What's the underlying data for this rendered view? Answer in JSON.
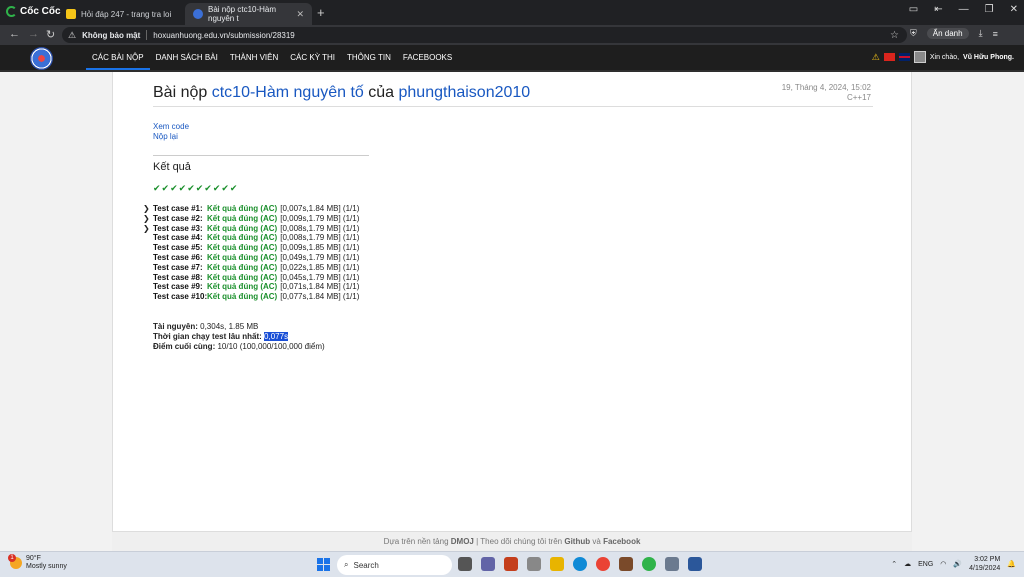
{
  "browser": {
    "brand": "Cốc Cốc",
    "tabs": [
      {
        "title": "Hỏi đáp 247 - trang tra loi"
      },
      {
        "title": "Bài nộp ctc10-Hàm nguyên t"
      }
    ],
    "security_label": "Không bảo mật",
    "url": "hoxuanhuong.edu.vn/submission/28319",
    "incognito_label": "Ẩn danh"
  },
  "site": {
    "menu": [
      "CÁC BÀI NỘP",
      "DANH SÁCH BÀI",
      "THÀNH VIÊN",
      "CÁC KỲ THI",
      "THÔNG TIN",
      "FACEBOOKS"
    ],
    "greeting_prefix": "Xin chào,",
    "username": "Vũ Hữu Phong."
  },
  "submission": {
    "title_prefix": "Bài nộp",
    "problem": "ctc10-Hàm nguyên tố",
    "of": "của",
    "user": "phungthaison2010",
    "date": "19, Tháng 4, 2024, 15:02",
    "language": "C++17",
    "view_code": "Xem code",
    "resubmit": "Nộp lại",
    "result_heading": "Kết quả",
    "check_count": 10,
    "cases": [
      {
        "label": "Test case #1:",
        "status": "Kết quả đúng (AC)",
        "detail": "[0,007s,1.84 MB] (1/1)",
        "expandable": true
      },
      {
        "label": "Test case #2:",
        "status": "Kết quả đúng (AC)",
        "detail": "[0,009s,1.79 MB] (1/1)",
        "expandable": true
      },
      {
        "label": "Test case #3:",
        "status": "Kết quả đúng (AC)",
        "detail": "[0,008s,1.79 MB] (1/1)",
        "expandable": true
      },
      {
        "label": "Test case #4:",
        "status": "Kết quả đúng (AC)",
        "detail": "[0,008s,1.79 MB] (1/1)",
        "expandable": false
      },
      {
        "label": "Test case #5:",
        "status": "Kết quả đúng (AC)",
        "detail": "[0,009s,1.85 MB] (1/1)",
        "expandable": false
      },
      {
        "label": "Test case #6:",
        "status": "Kết quả đúng (AC)",
        "detail": "[0,049s,1.79 MB] (1/1)",
        "expandable": false
      },
      {
        "label": "Test case #7:",
        "status": "Kết quả đúng (AC)",
        "detail": "[0,022s,1.85 MB] (1/1)",
        "expandable": false
      },
      {
        "label": "Test case #8:",
        "status": "Kết quả đúng (AC)",
        "detail": "[0,045s,1.79 MB] (1/1)",
        "expandable": false
      },
      {
        "label": "Test case #9:",
        "status": "Kết quả đúng (AC)",
        "detail": "[0,071s,1.84 MB] (1/1)",
        "expandable": false
      },
      {
        "label": "Test case #10:",
        "status": "Kết quả đúng (AC)",
        "detail": "[0,077s,1.84 MB] (1/1)",
        "expandable": false
      }
    ],
    "resources_label": "Tài nguyên:",
    "resources_value": "0,304s, 1.85 MB",
    "longest_label": "Thời gian chạy test lâu nhất:",
    "longest_value": "0,077s",
    "score_label": "Điểm cuối cùng:",
    "score_value": "10/10 (100,000/100,000 điểm)"
  },
  "footer": {
    "prefix": "Dựa trên nền tảng",
    "platform": "DMOJ",
    "middle": "| Theo dõi chúng tôi trên",
    "github": "Github",
    "and": "và",
    "facebook": "Facebook"
  },
  "taskbar": {
    "weather_badge": "1",
    "temperature": "90°F",
    "condition": "Mostly sunny",
    "search_placeholder": "Search",
    "lang": "ENG",
    "time": "3:02 PM",
    "date": "4/19/2024"
  }
}
